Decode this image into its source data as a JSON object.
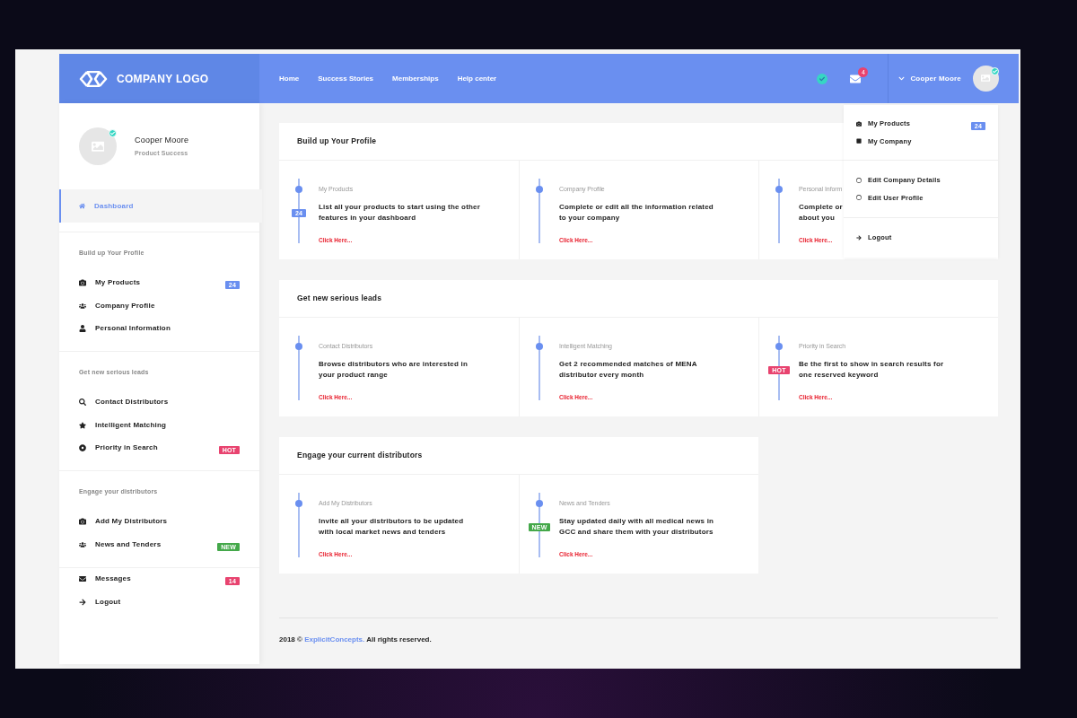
{
  "header": {
    "logo_text": "COMPANY LOGO",
    "nav": [
      {
        "label": "Home"
      },
      {
        "label": "Success Stories"
      },
      {
        "label": "Memberships"
      },
      {
        "label": "Help center"
      }
    ],
    "mail_badge": "4",
    "user_name": "Cooper Moore",
    "verified": true
  },
  "sidebar": {
    "profile": {
      "name": "Cooper Moore",
      "role": "Product Success",
      "verified": true
    },
    "groups": [
      {
        "items": [
          {
            "label": "Dashboard",
            "selected": true
          }
        ]
      },
      {
        "heading": "Build up Your Profile",
        "items": [
          {
            "label": "My Products",
            "selected": false,
            "badge": {
              "text": "24",
              "color": "#6a8ff0"
            }
          },
          {
            "label": "Company Profile",
            "selected": false
          },
          {
            "label": "Personal Information",
            "selected": false
          }
        ]
      },
      {
        "heading": "Get new serious leads",
        "items": [
          {
            "label": "Contact Distributors",
            "selected": false
          },
          {
            "label": "Intelligent Matching",
            "selected": false
          },
          {
            "label": "Priority in Search",
            "selected": false,
            "badge": {
              "text": "HOT",
              "color": "#e8436f"
            }
          }
        ]
      },
      {
        "heading": "Engage your distributors",
        "items": [
          {
            "label": "Add My Distributors",
            "selected": false
          },
          {
            "label": "News and Tenders",
            "selected": false,
            "badge": {
              "text": "NEW",
              "color": "#44a84a"
            }
          }
        ]
      },
      {
        "items": [
          {
            "label": "Messages",
            "selected": false,
            "badge": {
              "text": "14",
              "color": "#e8436f"
            }
          },
          {
            "label": "Logout",
            "selected": false
          }
        ]
      }
    ]
  },
  "sections": [
    {
      "title": "Build up Your Profile",
      "cards": [
        {
          "label": "My Products",
          "description": "List all your products to start using the other\nfeatures in your dashboard",
          "link": "Click Here...",
          "badge": {
            "text": "24",
            "color": "#6a8ff0"
          }
        },
        {
          "label": "Company Profile",
          "description": "Complete or edit all the information related\nto your company",
          "link": "Click Here..."
        },
        {
          "label": "Personal Inform",
          "description": "Complete or\nabout you",
          "link": "Click Here..."
        }
      ]
    },
    {
      "title": "Get new serious leads",
      "cards": [
        {
          "label": "Contact Distributors",
          "description": "Browse distributors who are interested in\nyour product range",
          "link": "Click Here..."
        },
        {
          "label": "Intelligent Matching",
          "description": "Get 2 recommended matches of MENA\ndistributor every month",
          "link": "Click Here..."
        },
        {
          "label": "Priority in Search",
          "description": "Be the first to show in search results for\none reserved keyword",
          "link": "Click Here...",
          "badge": {
            "text": "HOT",
            "color": "#e8436f"
          }
        }
      ]
    },
    {
      "title": "Engage your current distributors",
      "cards": [
        {
          "label": "Add My Distributors",
          "description": "Invite all your distributors to be updated\nwith local market news and tenders",
          "link": "Click Here..."
        },
        {
          "label": "News and Tenders",
          "description": "Stay updated daily with all medical news in\nGCC and share them with your distributors",
          "link": "Click Here...",
          "badge": {
            "text": "NEW",
            "color": "#44a84a"
          }
        }
      ]
    }
  ],
  "dropdown": {
    "groups": [
      [
        {
          "label": "My Products",
          "badge": {
            "text": "24",
            "color": "#6a8ff0"
          }
        },
        {
          "label": "My Company"
        }
      ],
      [
        {
          "label": "Edit Company Details"
        },
        {
          "label": "Edit User Profile"
        }
      ],
      [
        {
          "label": "Logout"
        }
      ]
    ]
  },
  "footer": {
    "prefix": "2018 ©",
    "link": "ExplicitConcepts.",
    "suffix": "All rights reserved."
  }
}
